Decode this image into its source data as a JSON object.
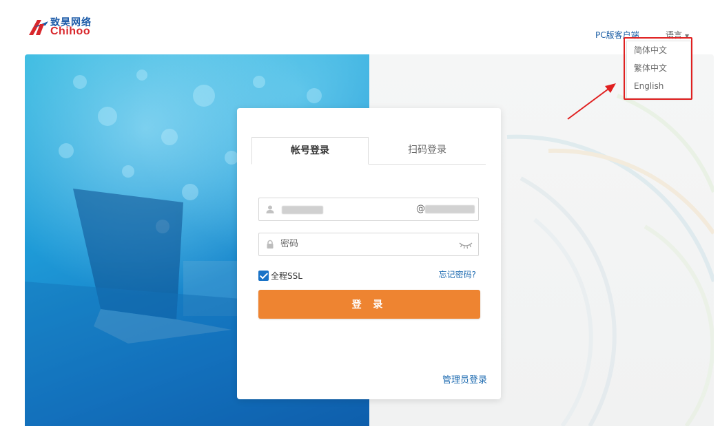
{
  "brand": {
    "name_cn": "致昊网络",
    "name_en": "Chihoo",
    "colors": {
      "blue": "#1b5aa8",
      "red": "#d8262b"
    }
  },
  "header": {
    "pc_client_link": "PC版客户端",
    "language_button": "语言",
    "language_menu": [
      "简体中文",
      "繁体中文",
      "English"
    ]
  },
  "login": {
    "tabs": {
      "account": "帐号登录",
      "qrcode": "扫码登录"
    },
    "username_suffix": "@",
    "password_placeholder": "密码",
    "ssl_label": "全程SSL",
    "ssl_checked": true,
    "forgot_link": "忘记密码?",
    "login_button": "登 录",
    "admin_link": "管理员登录"
  },
  "colors": {
    "accent_orange": "#ee8431",
    "link_blue": "#1c6ab0",
    "annotation_red": "#e02020"
  },
  "icons": [
    "user-icon",
    "lock-icon",
    "eye-closed-icon",
    "check-icon",
    "chevron-down-icon"
  ]
}
